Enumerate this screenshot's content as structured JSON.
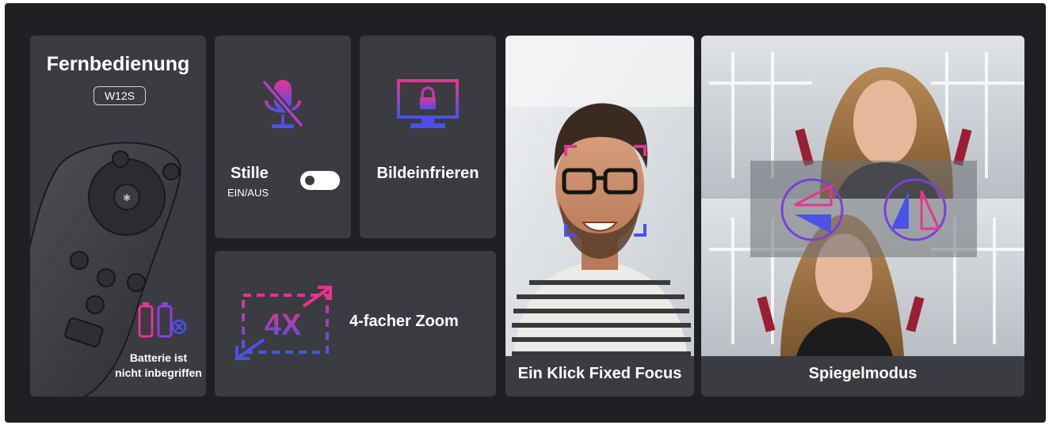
{
  "colors": {
    "background": "#1f2024",
    "card": "#3b3c41",
    "accent_pink": "#e8338f",
    "accent_blue": "#4a52e8",
    "text": "#ffffff"
  },
  "remote_card": {
    "title": "Fernbedienung",
    "model_badge": "W12S",
    "battery_note_line1": "Batterie ist",
    "battery_note_line2": "nicht inbegriffen",
    "icons": [
      "remote-control",
      "battery-crossed-out"
    ]
  },
  "silence_card": {
    "title": "Stille",
    "subtitle": "EIN/AUS",
    "icons": [
      "muted-microphone",
      "toggle-switch"
    ]
  },
  "freeze_card": {
    "title": "Bildeinfrieren",
    "icons": [
      "monitor-lock"
    ]
  },
  "zoom_card": {
    "zoom_label": "4X",
    "title": "4-facher Zoom",
    "icons": [
      "zoom-frame-arrows"
    ]
  },
  "focus_card": {
    "title": "Ein Klick Fixed Focus",
    "icons": [
      "focus-brackets"
    ]
  },
  "mirror_card": {
    "title": "Spiegelmodus",
    "icons": [
      "flip-vertical",
      "flip-horizontal"
    ]
  }
}
